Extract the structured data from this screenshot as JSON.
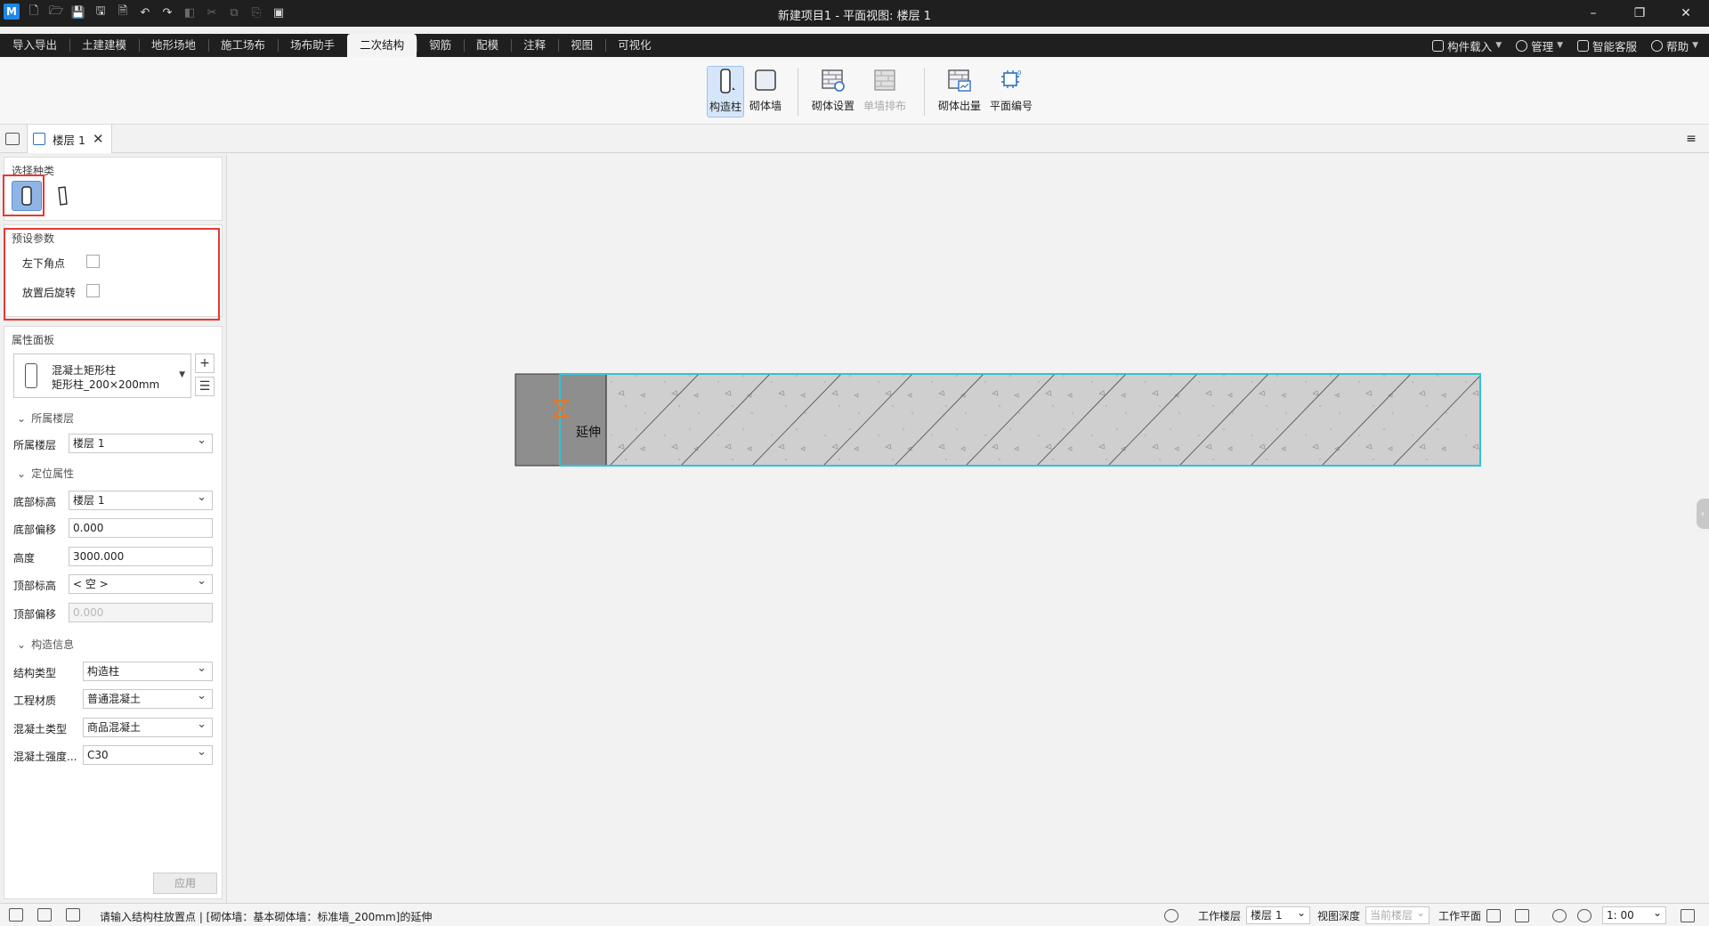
{
  "window": {
    "title": "新建项目1 - 平面视图: 楼层 1",
    "logo": "M"
  },
  "ribbon_tabs": [
    "导入导出",
    "土建建模",
    "地形场地",
    "施工场布",
    "场布助手",
    "二次结构",
    "钢筋",
    "配模",
    "注释",
    "视图",
    "可视化"
  ],
  "active_tab": "二次结构",
  "right_menu": {
    "component_load": "构件载入",
    "manage": "管理",
    "service": "智能客服",
    "help": "帮助"
  },
  "toolbar": {
    "tools": [
      {
        "label": "构造柱",
        "icon": "column-icon",
        "state": "active"
      },
      {
        "label": "砌体墙",
        "icon": "wall-icon",
        "state": "normal"
      },
      {
        "label": "砌体设置",
        "icon": "masonry-settings-icon",
        "state": "normal"
      },
      {
        "label": "单墙排布",
        "icon": "single-wall-layout-icon",
        "state": "disabled"
      },
      {
        "label": "砌体出量",
        "icon": "masonry-quantity-icon",
        "state": "normal"
      },
      {
        "label": "平面编号",
        "icon": "plan-numbering-icon",
        "state": "normal"
      }
    ]
  },
  "doc_tab": {
    "label": "楼层 1"
  },
  "left_panel": {
    "select_kind_title": "选择种类",
    "preset_title": "预设参数",
    "preset_params": [
      {
        "label": "左下角点",
        "checked": false
      },
      {
        "label": "放置后旋转",
        "checked": false
      }
    ],
    "property_title": "属性面板",
    "type_name": "混凝土矩形柱",
    "type_size": "矩形柱_200×200mm",
    "groups": {
      "floor": "所属楼层",
      "position": "定位属性",
      "construct": "构造信息"
    },
    "props": {
      "floor_label": "所属楼层",
      "floor_value": "楼层 1",
      "base_level_label": "底部标高",
      "base_level_value": "楼层 1",
      "base_offset_label": "底部偏移",
      "base_offset_value": "0.000",
      "height_label": "高度",
      "height_value": "3000.000",
      "top_level_label": "顶部标高",
      "top_level_value": "< 空 >",
      "top_offset_label": "顶部偏移",
      "top_offset_value": "0.000",
      "struct_type_label": "结构类型",
      "struct_type_value": "构造柱",
      "material_label": "工程材质",
      "material_value": "普通混凝土",
      "concrete_type_label": "混凝土类型",
      "concrete_type_value": "商品混凝土",
      "strength_label": "混凝土强度...",
      "strength_value": "C30"
    },
    "apply_label": "应用"
  },
  "canvas": {
    "extend_label": "延伸"
  },
  "statusbar": {
    "prompt": "请输入结构柱放置点 | [砌体墙：基本砌体墙：标准墙_200mm]的延伸",
    "work_floor_label": "工作楼层",
    "work_floor_value": "楼层 1",
    "view_depth_label": "视图深度",
    "view_depth_value": "当前楼层",
    "work_plane_label": "工作平面",
    "scale_value": "1:  00"
  },
  "colors": {
    "title_bg": "#1f1f1f",
    "accent_blue": "#8fb5e6",
    "highlight_red": "#e53935",
    "wall_outline": "#2ec4d6",
    "hourglass": "#e0792b"
  }
}
